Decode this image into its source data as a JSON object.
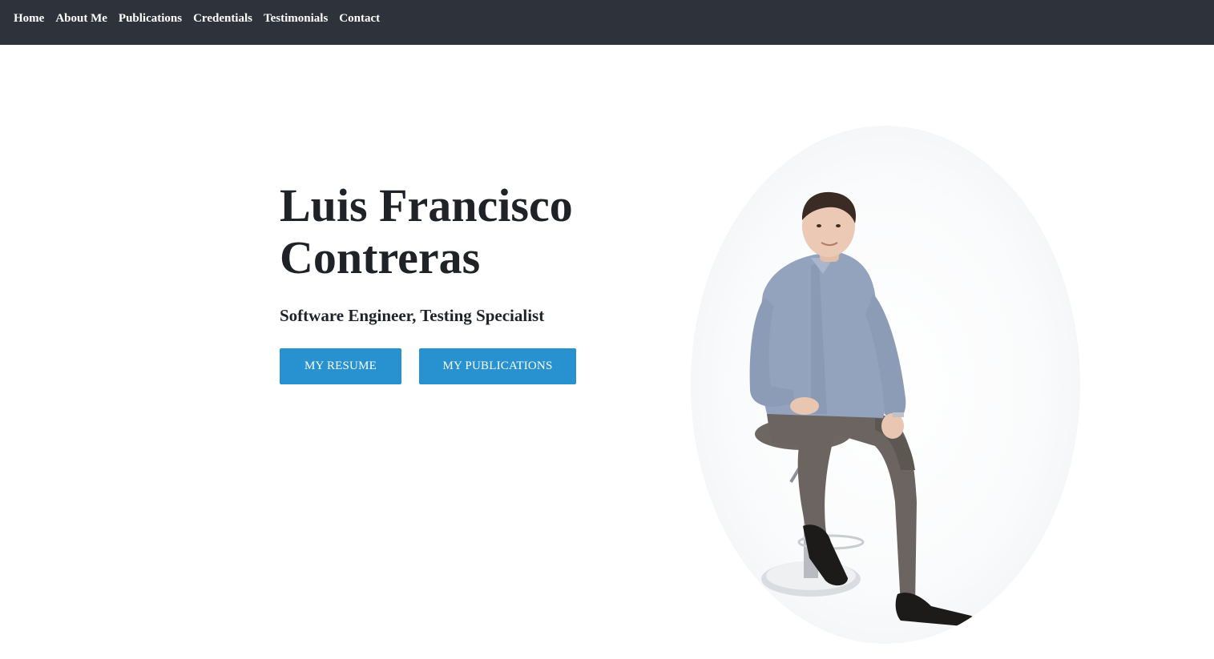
{
  "nav": {
    "items": [
      {
        "label": "Home"
      },
      {
        "label": "About Me"
      },
      {
        "label": "Publications"
      },
      {
        "label": "Credentials"
      },
      {
        "label": "Testimonials"
      },
      {
        "label": "Contact"
      }
    ]
  },
  "hero": {
    "title_line1": "Luis Francisco",
    "title_line2": "Contreras",
    "subtitle": "Software Engineer, Testing Specialist",
    "buttons": {
      "resume_label": "MY RESUME",
      "publications_label": "MY PUBLICATIONS"
    },
    "portrait": {
      "icon": "person-seated-photo"
    }
  },
  "colors": {
    "navbar_bg": "#2e333b",
    "button_bg": "#2891cf",
    "text": "#1f2328"
  }
}
